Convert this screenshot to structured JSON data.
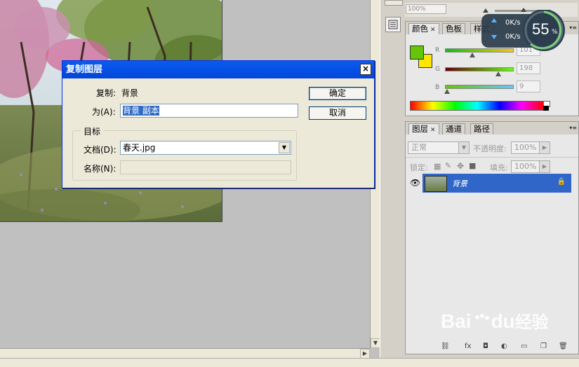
{
  "dialog": {
    "title": "复制图层",
    "close_glyph": "×",
    "copy_label": "复制:",
    "copy_value": "背景",
    "as_label": "为(A):",
    "as_value": "背景 副本",
    "dest_group": "目标",
    "doc_label": "文档(D):",
    "doc_value": "春天.jpg",
    "name_label": "名称(N):",
    "name_value": "",
    "ok": "确定",
    "cancel": "取消"
  },
  "nav": {
    "zoom": "100%"
  },
  "speed": {
    "up": "0K/s",
    "down": "0K/s",
    "percent": "55",
    "percent_unit": "%"
  },
  "color_panel": {
    "tabs": [
      "颜色",
      "色板",
      "样式"
    ],
    "r_label": "R",
    "g_label": "G",
    "b_label": "B",
    "r": "101",
    "g": "198",
    "b": "9",
    "r_level": 0.396,
    "g_level": 0.776,
    "b_level": 0.035,
    "fg_color": "#65c609",
    "bg_color": "#ffe600"
  },
  "layers_panel": {
    "tabs": [
      "图层",
      "通道",
      "路径"
    ],
    "blend_mode": "正常",
    "opacity_label": "不透明度:",
    "opacity": "100%",
    "lock_label": "锁定:",
    "fill_label": "填充:",
    "fill": "100%",
    "layer_name": "背景"
  },
  "watermark": {
    "text": "Bai",
    "paw": "du",
    "tail": "经验"
  },
  "colors": {
    "titlebar": "#0246d8",
    "selection": "#3166c9"
  }
}
